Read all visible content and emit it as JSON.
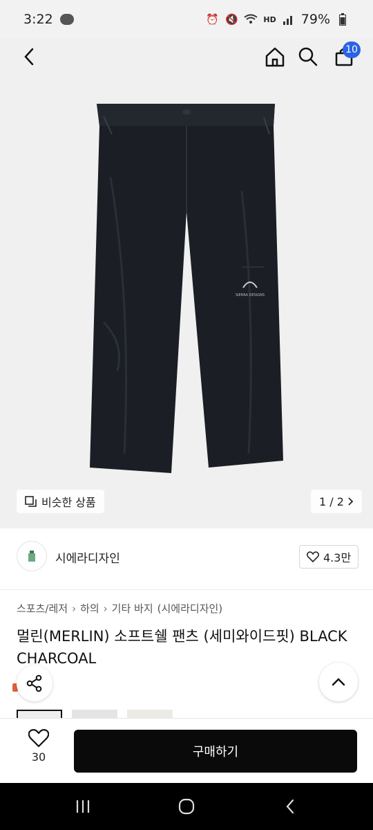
{
  "status_bar": {
    "time": "3:22",
    "talk_badge": "TALK",
    "network_label": "HD",
    "battery": "79%"
  },
  "header": {
    "cart_count": "10"
  },
  "gallery": {
    "similar_label": "비슷한 상품",
    "pager": "1 / 2",
    "logo_text": "SIERRA DESIGNS"
  },
  "seller": {
    "name": "시에라디자인",
    "favorites": "4.3만"
  },
  "breadcrumb": {
    "items": [
      "스포츠/레저",
      "하의",
      "기타 바지",
      "(시에라디자인)"
    ]
  },
  "product": {
    "title": "멀린(MERLIN) 소프트쉘 팬츠 (세미와이드핏) BLACK CHARCOAL"
  },
  "actions": {
    "like_count": "30",
    "buy_label": "구매하기"
  },
  "colors": {
    "accent": "#2b63e6",
    "buy_button": "#0a0a0a",
    "highlight": "#e0603a"
  }
}
